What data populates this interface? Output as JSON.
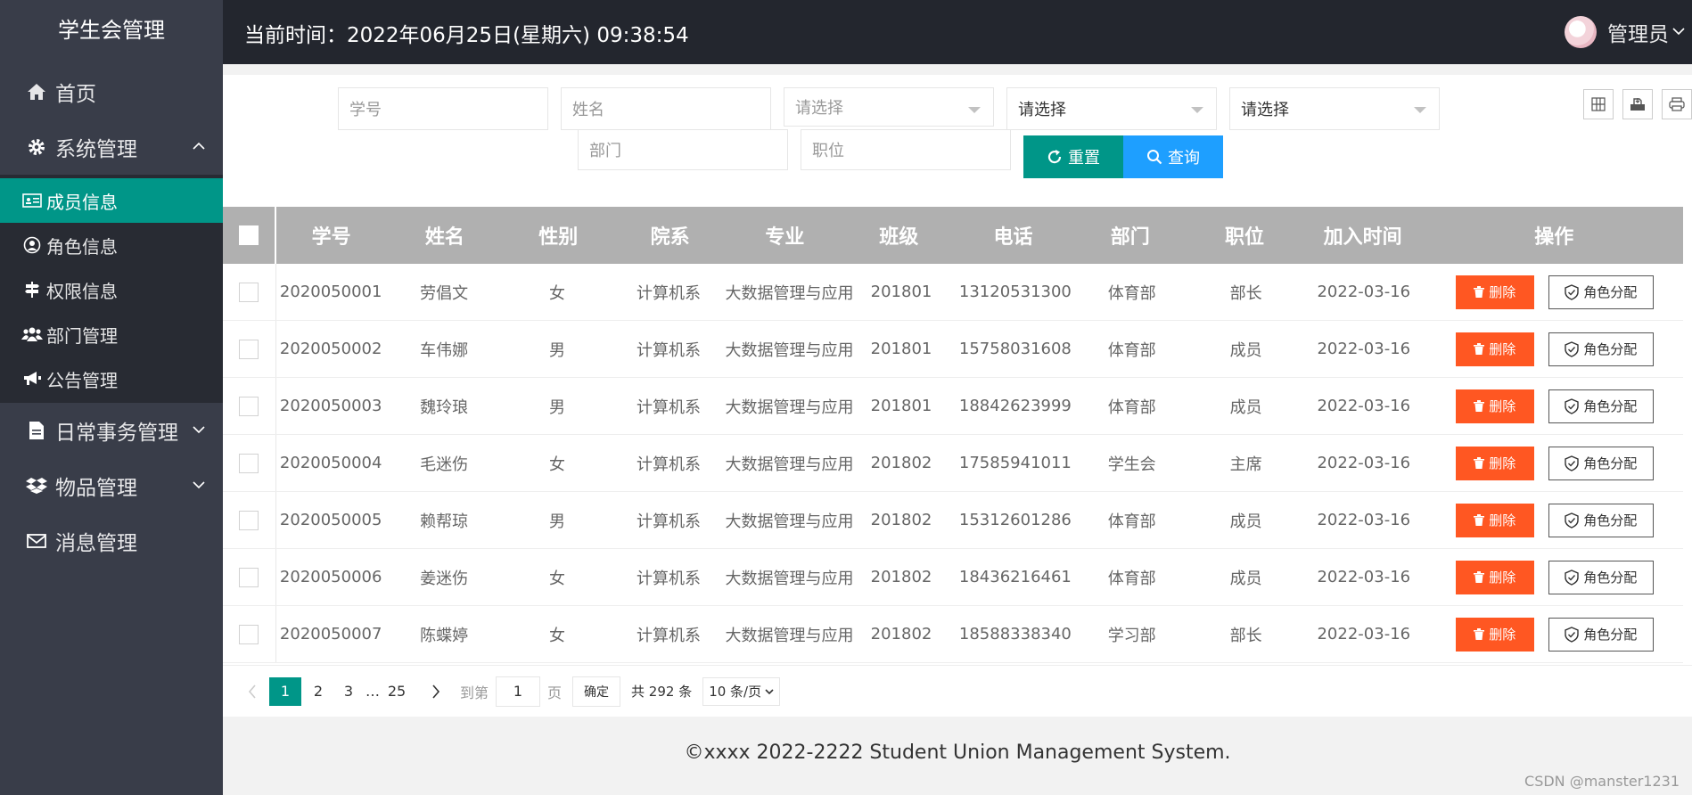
{
  "app": {
    "title": "学生会管理"
  },
  "header": {
    "clock": "当前时间：2022年06月25日(星期六) 09:38:54",
    "user": "管理员"
  },
  "sidebar": {
    "items": [
      {
        "label": "首页",
        "icon": "home-icon"
      },
      {
        "label": "系统管理",
        "icon": "gear-icon"
      },
      {
        "label": "日常事务管理",
        "icon": "document-icon"
      },
      {
        "label": "物品管理",
        "icon": "box-icon"
      },
      {
        "label": "消息管理",
        "icon": "envelope-icon"
      }
    ],
    "subitems": [
      {
        "label": "成员信息",
        "icon": "id-card-icon"
      },
      {
        "label": "角色信息",
        "icon": "user-circle-icon"
      },
      {
        "label": "权限信息",
        "icon": "sign-icon"
      },
      {
        "label": "部门管理",
        "icon": "users-icon"
      },
      {
        "label": "公告管理",
        "icon": "bullhorn-icon"
      }
    ]
  },
  "search": {
    "id_placeholder": "学号",
    "name_placeholder": "姓名",
    "select1": "请选择",
    "select2": "请选择",
    "select3": "请选择",
    "dept_placeholder": "部门",
    "pos_placeholder": "职位",
    "reset": "重置",
    "query": "查询"
  },
  "table": {
    "headers": [
      "学号",
      "姓名",
      "性别",
      "院系",
      "专业",
      "班级",
      "电话",
      "部门",
      "职位",
      "加入时间",
      "操作"
    ],
    "delete_label": "删除",
    "role_label": "角色分配",
    "rows": [
      [
        "2020050001",
        "劳倡文",
        "女",
        "计算机系",
        "大数据管理与应用",
        "201801",
        "13120531300",
        "体育部",
        "部长",
        "2022-03-16"
      ],
      [
        "2020050002",
        "车伟娜",
        "男",
        "计算机系",
        "大数据管理与应用",
        "201801",
        "15758031608",
        "体育部",
        "成员",
        "2022-03-16"
      ],
      [
        "2020050003",
        "魏玲琅",
        "男",
        "计算机系",
        "大数据管理与应用",
        "201801",
        "18842623999",
        "体育部",
        "成员",
        "2022-03-16"
      ],
      [
        "2020050004",
        "毛迷伤",
        "女",
        "计算机系",
        "大数据管理与应用",
        "201802",
        "17585941011",
        "学生会",
        "主席",
        "2022-03-16"
      ],
      [
        "2020050005",
        "赖帮琼",
        "男",
        "计算机系",
        "大数据管理与应用",
        "201802",
        "15312601286",
        "体育部",
        "成员",
        "2022-03-16"
      ],
      [
        "2020050006",
        "姜迷伤",
        "女",
        "计算机系",
        "大数据管理与应用",
        "201802",
        "18436216461",
        "体育部",
        "成员",
        "2022-03-16"
      ],
      [
        "2020050007",
        "陈蝶婷",
        "女",
        "计算机系",
        "大数据管理与应用",
        "201802",
        "18588338340",
        "学习部",
        "部长",
        "2022-03-16"
      ]
    ]
  },
  "pager": {
    "pages": [
      "1",
      "2",
      "3",
      "…",
      "25"
    ],
    "goto_label": "到第",
    "goto_value": "1",
    "page_unit": "页",
    "confirm": "确定",
    "total": "共 292 条",
    "per_page": "10 条/页"
  },
  "footer": "©xxxx 2022-2222 Student Union Management System.",
  "watermark": "CSDN @manster1231",
  "colors": {
    "sidebar": "#393d49",
    "header": "#23262e",
    "accent": "#009688",
    "query": "#1e9fff",
    "danger": "#ff5722"
  }
}
